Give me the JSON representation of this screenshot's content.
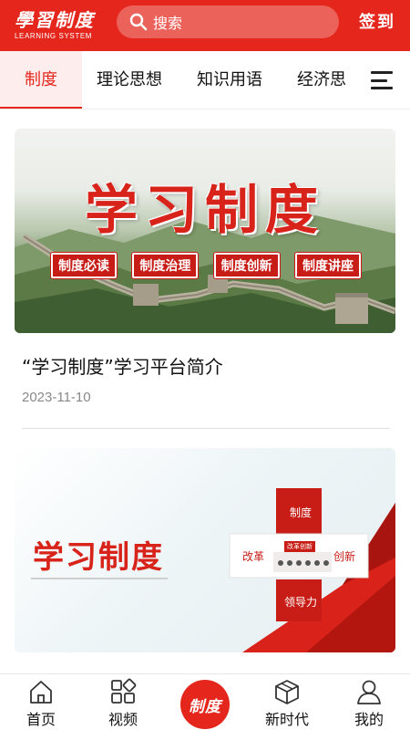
{
  "header": {
    "logo_main": "學習制度",
    "logo_sub": "LEARNING SYSTEM",
    "search_placeholder": "搜索",
    "signin_label": "签到",
    "bg_color": "#e4261c"
  },
  "tabs": [
    {
      "label": "制度",
      "active": true
    },
    {
      "label": "理论思想",
      "active": false
    },
    {
      "label": "知识用语",
      "active": false
    },
    {
      "label": "经济思",
      "active": false
    }
  ],
  "menu_icon": "hamburger-icon",
  "articles": [
    {
      "banner_title": "学习制度",
      "banner_tags": [
        "制度必读",
        "制度治理",
        "制度创新",
        "制度讲座"
      ],
      "title": "“学习制度”学习平台简介",
      "date": "2023-11-10"
    },
    {
      "banner_title": "学习制度",
      "diagram_labels": {
        "top": "制度",
        "left": "改革",
        "right": "创新",
        "bottom": "领导力",
        "sign": "改革创新"
      }
    }
  ],
  "bottom_nav": [
    {
      "label": "首页",
      "icon": "home-icon"
    },
    {
      "label": "视频",
      "icon": "grid-icon"
    },
    {
      "label": "制度",
      "icon": "center-logo"
    },
    {
      "label": "新时代",
      "icon": "cube-icon"
    },
    {
      "label": "我的",
      "icon": "user-icon"
    }
  ],
  "accent_color": "#e4261c"
}
